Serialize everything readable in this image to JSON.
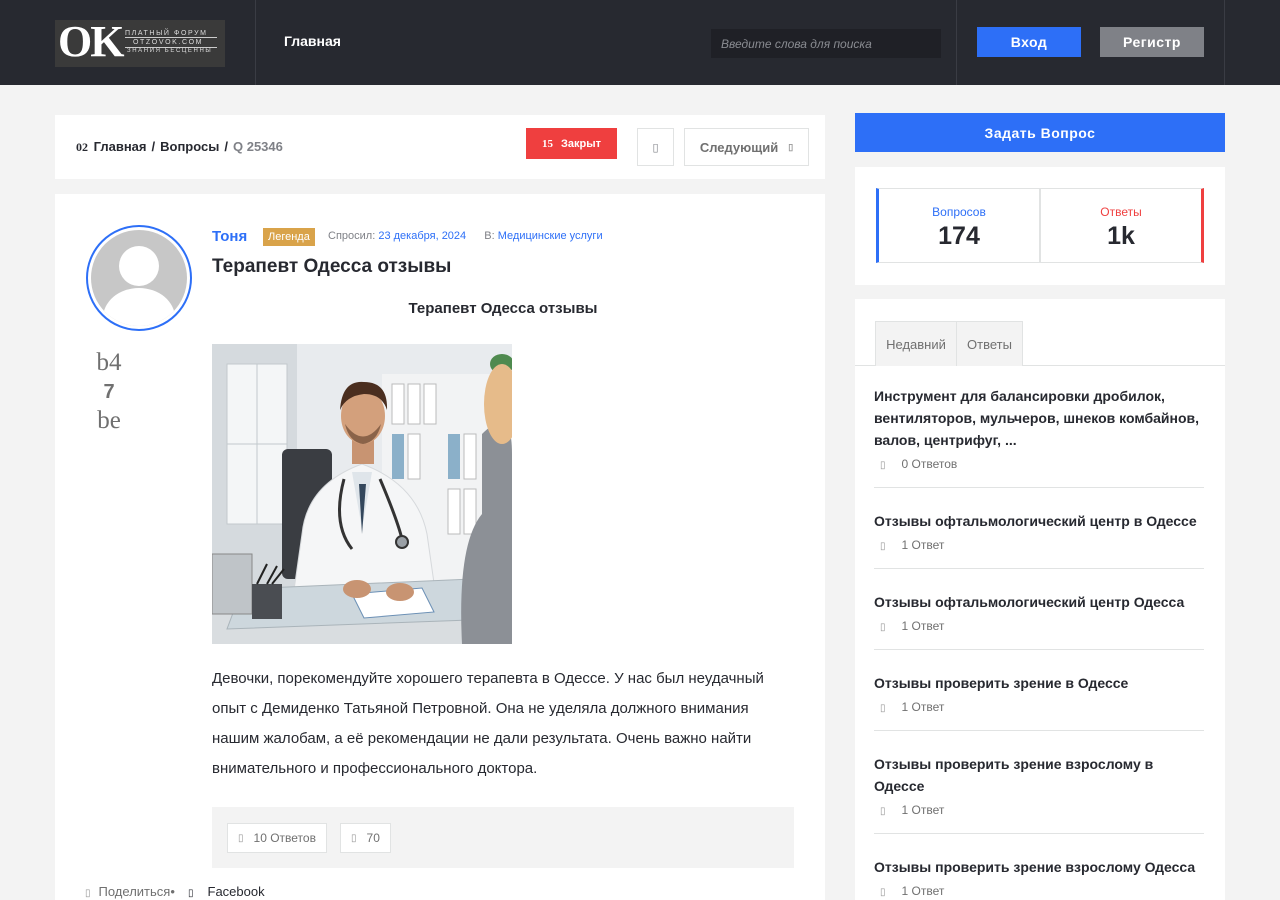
{
  "header": {
    "logo": {
      "big": "OK",
      "line1": "ПЛАТНЫЙ ФОРУМ",
      "line2": "OTZOVOK.COM",
      "line3": "ЗНАНИЯ БЕСЦЕННЫ"
    },
    "nav_home": "Главная",
    "search_placeholder": "Введите слова для поиска",
    "login_label": "Вход",
    "register_label": "Регистр"
  },
  "breadcrumb": {
    "num": "02",
    "home": "Главная",
    "questions": "Вопросы",
    "qid": "Q 25346",
    "closed_num": "15",
    "closed_label": "Закрыт",
    "icon_btn": "▯",
    "next_label": "Следующий",
    "next_icon": "▯"
  },
  "question": {
    "vote_up": "b4",
    "vote_count": "7",
    "vote_down": "be",
    "author": "Тоня",
    "badge": "Легенда",
    "asked_label": "Спросил:",
    "asked_date": "23 декабря, 2024",
    "in_label": "В:",
    "category": "Медицинские услуги",
    "title": "Терапевт Одесса отзывы",
    "subtitle": "Терапевт Одесса отзывы",
    "text": "Девочки, порекомендуйте хорошего терапевта в Одессе. У нас был неудачный опыт с Демиденко Татьяной Петровной. Она не уделяла должного внимания нашим жалобам, а её рекомендации не дали результата. Очень важно найти внимательного и профессионального доктора.",
    "answers_chip": "10 Ответов",
    "views_chip": "70",
    "chip_icon": "▯",
    "share_label": "Поделиться",
    "share_bullet": "•",
    "facebook_label": "Facebook"
  },
  "sidebar": {
    "ask_button": "Задать Вопрос",
    "stats": [
      {
        "label": "Вопросов",
        "value": "174"
      },
      {
        "label": "Ответы",
        "value": "1k"
      }
    ],
    "tabs": [
      "Недавний",
      "Ответы"
    ],
    "recent": [
      {
        "title": "Инструмент для балансировки дробилок, вентиляторов, мульчеров, шнеков комбайнов, валов, центрифуг, ...",
        "count": "0 Ответов"
      },
      {
        "title": "Отзывы офтальмологический центр в Одессе",
        "count": "1 Ответ"
      },
      {
        "title": "Отзывы офтальмологический центр Одесса",
        "count": "1 Ответ"
      },
      {
        "title": "Отзывы проверить зрение в Одессе",
        "count": "1 Ответ"
      },
      {
        "title": "Отзывы проверить зрение взрослому в Одессе",
        "count": "1 Ответ"
      },
      {
        "title": "Отзывы проверить зрение взрослому Одесса",
        "count": "1 Ответ"
      }
    ]
  },
  "colors": {
    "accent": "#2d6ff7",
    "danger": "#ef3f3f",
    "header_bg": "#272930",
    "badge_gold": "#d9a34a"
  }
}
